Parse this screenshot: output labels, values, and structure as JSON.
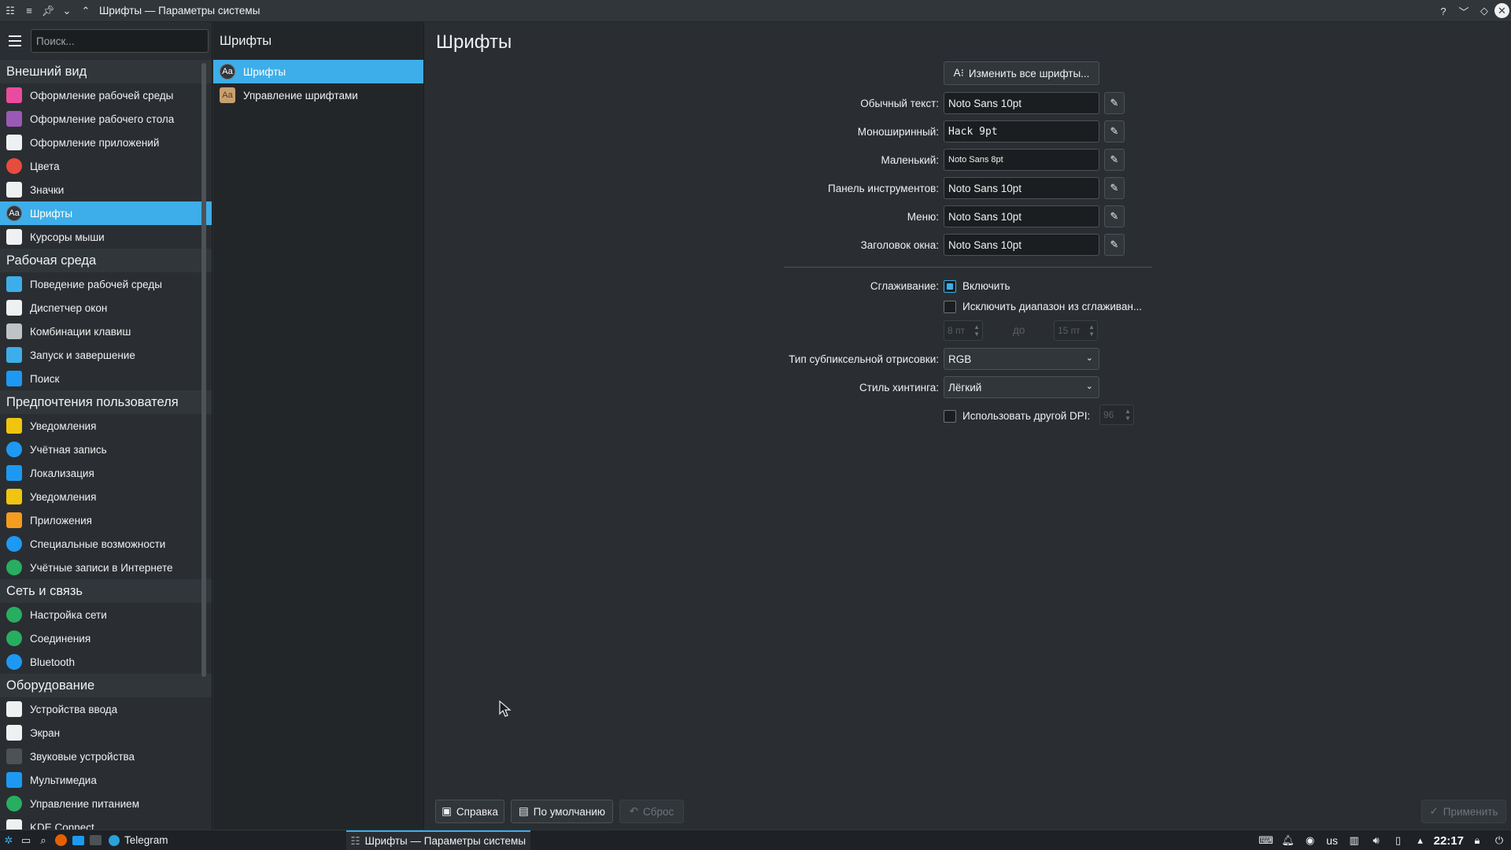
{
  "window": {
    "title": "Шрифты — Параметры системы",
    "help_icon": "?",
    "min_icon": "﹀",
    "max_icon": "◇",
    "close_icon": "✕"
  },
  "sidebar": {
    "search_placeholder": "Поиск...",
    "categories": [
      {
        "title": "Внешний вид",
        "items": [
          {
            "label": "Оформление рабочей среды",
            "icon": "workspace-theme-icon",
            "color": "#e94c9f"
          },
          {
            "label": "Оформление рабочего стола",
            "icon": "desktop-theme-icon",
            "color": "#9b59b6"
          },
          {
            "label": "Оформление приложений",
            "icon": "app-style-icon",
            "color": "#eff0f1"
          },
          {
            "label": "Цвета",
            "icon": "colors-icon",
            "color": "#e74c3c"
          },
          {
            "label": "Значки",
            "icon": "icons-icon",
            "color": "#eff0f1"
          },
          {
            "label": "Шрифты",
            "icon": "fonts-icon",
            "color": "#31363b",
            "active": true
          },
          {
            "label": "Курсоры мыши",
            "icon": "mouse-cursor-icon",
            "color": "#eff0f1"
          }
        ]
      },
      {
        "title": "Рабочая среда",
        "items": [
          {
            "label": "Поведение рабочей среды",
            "icon": "workspace-behavior-icon",
            "color": "#3daee9"
          },
          {
            "label": "Диспетчер окон",
            "icon": "window-manager-icon",
            "color": "#eff0f1"
          },
          {
            "label": "Комбинации клавиш",
            "icon": "shortcuts-icon",
            "color": "#bdc3c7"
          },
          {
            "label": "Запуск и завершение",
            "icon": "startup-icon",
            "color": "#3daee9"
          },
          {
            "label": "Поиск",
            "icon": "search-settings-icon",
            "color": "#1d99f3"
          }
        ]
      },
      {
        "title": "Предпочтения пользователя",
        "items": [
          {
            "label": "Уведомления",
            "icon": "notifications-icon",
            "color": "#f1c40f"
          },
          {
            "label": "Учётная запись",
            "icon": "user-account-icon",
            "color": "#1d99f3"
          },
          {
            "label": "Локализация",
            "icon": "locale-icon",
            "color": "#1d99f3"
          },
          {
            "label": "Уведомления",
            "icon": "notifications-icon",
            "color": "#f1c40f"
          },
          {
            "label": "Приложения",
            "icon": "applications-icon",
            "color": "#f39c1f"
          },
          {
            "label": "Специальные возможности",
            "icon": "accessibility-icon",
            "color": "#1d99f3"
          },
          {
            "label": "Учётные записи в Интернете",
            "icon": "online-accounts-icon",
            "color": "#27ae60"
          }
        ]
      },
      {
        "title": "Сеть и связь",
        "items": [
          {
            "label": "Настройка сети",
            "icon": "network-icon",
            "color": "#27ae60"
          },
          {
            "label": "Соединения",
            "icon": "connections-icon",
            "color": "#27ae60"
          },
          {
            "label": "Bluetooth",
            "icon": "bluetooth-icon",
            "color": "#1d99f3"
          }
        ]
      },
      {
        "title": "Оборудование",
        "items": [
          {
            "label": "Устройства ввода",
            "icon": "input-devices-icon",
            "color": "#eff0f1"
          },
          {
            "label": "Экран",
            "icon": "display-icon",
            "color": "#eff0f1"
          },
          {
            "label": "Звуковые устройства",
            "icon": "audio-devices-icon",
            "color": "#4d5257"
          },
          {
            "label": "Мультимедиа",
            "icon": "multimedia-icon",
            "color": "#1d99f3"
          },
          {
            "label": "Управление питанием",
            "icon": "power-icon",
            "color": "#27ae60"
          },
          {
            "label": "KDE Connect",
            "icon": "kde-connect-icon",
            "color": "#eff0f1"
          }
        ]
      }
    ]
  },
  "midpane": {
    "title": "Шрифты",
    "items": [
      {
        "label": "Шрифты",
        "active": true
      },
      {
        "label": "Управление шрифтами",
        "active": false
      }
    ]
  },
  "main": {
    "title": "Шрифты",
    "change_all_label": "Изменить все шрифты...",
    "font_rows": [
      {
        "label": "Обычный текст:",
        "value": "Noto Sans 10pt",
        "style": ""
      },
      {
        "label": "Моноширинный:",
        "value": "Hack 9pt",
        "style": "mono"
      },
      {
        "label": "Маленький:",
        "value": "Noto Sans 8pt",
        "style": "small"
      },
      {
        "label": "Панель инструментов:",
        "value": "Noto Sans 10pt",
        "style": ""
      },
      {
        "label": "Меню:",
        "value": "Noto Sans 10pt",
        "style": ""
      },
      {
        "label": "Заголовок окна:",
        "value": "Noto Sans 10pt",
        "style": ""
      }
    ],
    "antialiasing_label": "Сглаживание:",
    "antialiasing_enable": "Включить",
    "antialiasing_checked": true,
    "exclude_range_label": "Исключить диапазон из сглаживан...",
    "exclude_checked": false,
    "range_from": "8 пт",
    "range_to_label": "до",
    "range_to": "15 пт",
    "subpixel_label": "Тип субпиксельной отрисовки:",
    "subpixel_value": "RGB",
    "hinting_label": "Стиль хинтинга:",
    "hinting_value": "Лёгкий",
    "dpi_label": "Использовать другой DPI:",
    "dpi_checked": false,
    "dpi_value": "96",
    "buttons": {
      "help": "Справка",
      "defaults": "По умолчанию",
      "reset": "Сброс",
      "apply": "Применить"
    }
  },
  "taskbar": {
    "tasks": [
      {
        "label": "Telegram",
        "active": false
      },
      {
        "label": "Шрифты — Параметры системы",
        "active": true
      }
    ],
    "keyboard_layout": "us",
    "clock": "22:17"
  },
  "colors": {
    "accent": "#3daee9",
    "background": "#2a2e32",
    "panel": "#232629"
  }
}
